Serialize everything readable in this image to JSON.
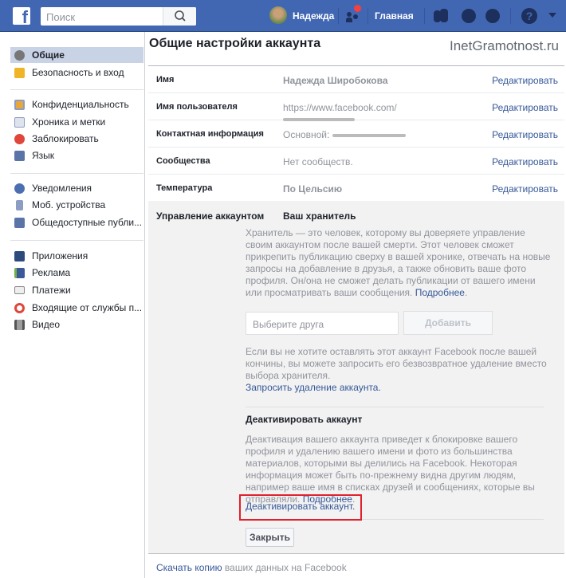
{
  "topbar": {
    "search_placeholder": "Поиск",
    "user_name": "Надежда",
    "home": "Главная"
  },
  "sidebar": {
    "items": [
      {
        "label": "Общие",
        "icon": "gears-icon"
      },
      {
        "label": "Безопасность и вход",
        "icon": "shield-badge-icon"
      },
      {
        "label": "Конфиденциальность",
        "icon": "lock-icon"
      },
      {
        "label": "Хроника и метки",
        "icon": "timeline-icon"
      },
      {
        "label": "Заблокировать",
        "icon": "block-icon"
      },
      {
        "label": "Язык",
        "icon": "language-icon"
      },
      {
        "label": "Уведомления",
        "icon": "globe-icon"
      },
      {
        "label": "Моб. устройства",
        "icon": "mobile-icon"
      },
      {
        "label": "Общедоступные публи...",
        "icon": "rss-icon"
      },
      {
        "label": "Приложения",
        "icon": "apps-icon"
      },
      {
        "label": "Реклама",
        "icon": "ads-icon"
      },
      {
        "label": "Платежи",
        "icon": "card-icon"
      },
      {
        "label": "Входящие от службы п...",
        "icon": "lifebuoy-icon"
      },
      {
        "label": "Видео",
        "icon": "film-icon"
      }
    ]
  },
  "main": {
    "title": "Общие настройки аккаунта",
    "watermark": "InetGramotnost.ru",
    "edit_label": "Редактировать",
    "rows": [
      {
        "label": "Имя",
        "value": "Надежда Широбокова"
      },
      {
        "label": "Имя пользователя",
        "value": "https://www.facebook.com/"
      },
      {
        "label": "Контактная информация",
        "value": "Основной:"
      },
      {
        "label": "Сообщества",
        "value": "Нет сообществ."
      },
      {
        "label": "Температура",
        "value": "По Цельсию"
      }
    ],
    "manage": {
      "label": "Управление аккаунтом",
      "heir_title": "Ваш хранитель",
      "heir_text": "Хранитель — это человек, которому вы доверяете управление своим аккаунтом после вашей смерти. Этот человек сможет прикрепить публикацию сверху в вашей хронике, отвечать на новые запросы на добавление в друзья, а также обновить ваше фото профиля. Он/она не сможет делать публикации от вашего имени или просматривать ваши сообщения.",
      "more": "Подробнее",
      "friend_placeholder": "Выберите друга",
      "add_button": "Добавить",
      "delete_text": "Если вы не хотите оставлять этот аккаунт Facebook после вашей кончины, вы можете запросить его безвозвратное удаление вместо выбора хранителя.",
      "delete_link": "Запросить удаление аккаунта.",
      "deactivate_title": "Деактивировать аккаунт",
      "deactivate_text": "Деактивация вашего аккаунта приведет к блокировке вашего профиля и удалению вашего имени и фото из большинства материалов, которыми вы делились на Facebook. Некоторая информация может быть по-прежнему видна другим людям, например ваше имя в списках друзей и сообщениях, которые вы отправляли.",
      "deactivate_link": "Деактивировать аккаунт.",
      "close_button": "Закрыть"
    },
    "footer": {
      "link": "Скачать копию",
      "rest": " ваших данных на Facebook"
    }
  }
}
